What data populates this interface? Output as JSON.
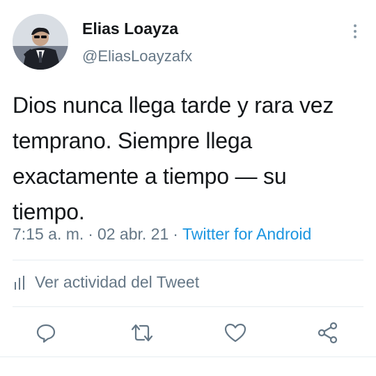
{
  "user": {
    "name": "Elias Loayza",
    "handle": "@EliasLoayzafx"
  },
  "tweet": {
    "text": "Dios nunca llega tarde y rara vez temprano. Siempre llega exactamente a tiempo — su tiempo.",
    "time": "7:15 a. m.",
    "separator": "·",
    "date": "02 abr. 21",
    "source": "Twitter for Android"
  },
  "activity": {
    "label": "Ver actividad del Tweet"
  },
  "icons": {
    "more": "more-vertical-icon",
    "activity": "bar-chart-icon",
    "reply": "reply-icon",
    "retweet": "retweet-icon",
    "like": "heart-icon",
    "share": "share-icon"
  },
  "colors": {
    "text": "#14171a",
    "secondary": "#657786",
    "link": "#1b95e0",
    "divider": "#e6ecf0"
  }
}
